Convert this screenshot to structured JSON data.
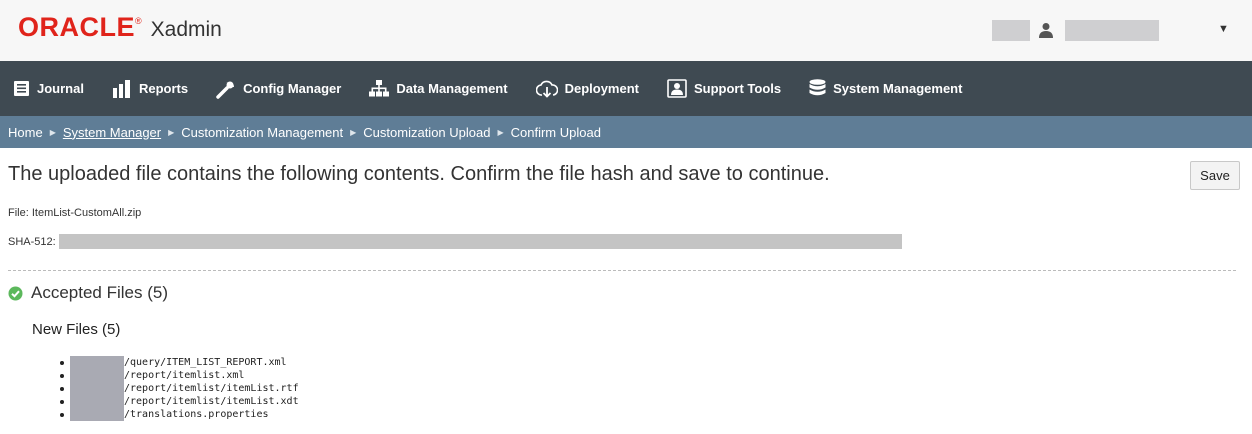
{
  "header": {
    "logo_text": "ORACLE",
    "logo_mark": "®",
    "app_name": "Xadmin",
    "user_icon": "user-icon",
    "dropdown_icon": "▼"
  },
  "nav": {
    "items": [
      {
        "label": "Journal",
        "icon": "journal-icon"
      },
      {
        "label": "Reports",
        "icon": "bar-chart-icon"
      },
      {
        "label": "Config Manager",
        "icon": "wrench-icon"
      },
      {
        "label": "Data Management",
        "icon": "sitemap-icon"
      },
      {
        "label": "Deployment",
        "icon": "cloud-download-icon"
      },
      {
        "label": "Support Tools",
        "icon": "support-icon"
      },
      {
        "label": "System Management",
        "icon": "database-icon"
      }
    ]
  },
  "breadcrumb": {
    "home": "Home",
    "system_manager": "System Manager",
    "customization_management": "Customization Management",
    "customization_upload": "Customization Upload",
    "confirm_upload": "Confirm Upload",
    "separator": "▶"
  },
  "main": {
    "title": "The uploaded file contains the following contents. Confirm the file hash and save to continue.",
    "save_label": "Save",
    "file_label": "File: ItemList-CustomAll.zip",
    "sha_label": "SHA-512:",
    "accepted_heading": "Accepted Files (5)",
    "new_files_heading": "New Files (5)",
    "files": [
      "/query/ITEM_LIST_REPORT.xml",
      "/report/itemlist.xml",
      "/report/itemlist/itemList.rtf",
      "/report/itemlist/itemList.xdt",
      "/translations.properties"
    ]
  },
  "colors": {
    "brand_red": "#e0241b",
    "nav_bg": "#3f4a52",
    "breadcrumb_bg": "#5f7d96",
    "success_green": "#5cb85c"
  }
}
